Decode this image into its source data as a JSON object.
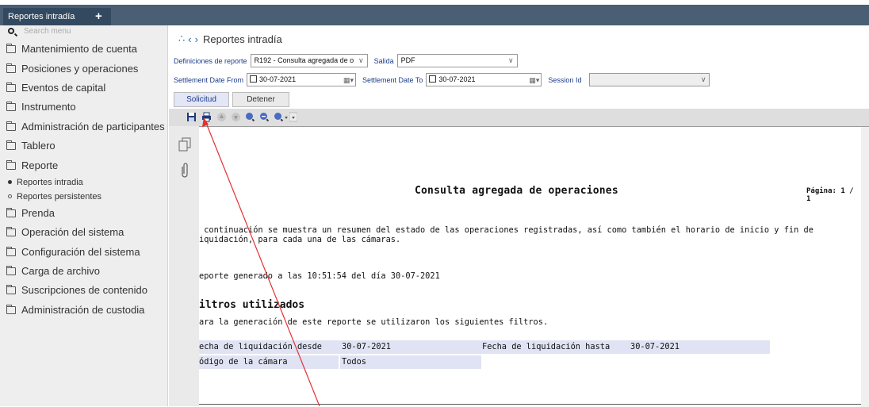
{
  "tab": {
    "title": "Reportes intradía",
    "add_icon": "plus-icon"
  },
  "sidebar": {
    "search_placeholder": "Search menu",
    "items": [
      {
        "label": "Mantenimiento de cuenta",
        "icon": "folder-icon"
      },
      {
        "label": "Posiciones y operaciones",
        "icon": "folder-icon"
      },
      {
        "label": "Eventos de capital",
        "icon": "folder-icon"
      },
      {
        "label": "Instrumento",
        "icon": "folder-icon"
      },
      {
        "label": "Administración de participantes",
        "icon": "folder-icon"
      },
      {
        "label": "Tablero",
        "icon": "folder-icon"
      },
      {
        "label": "Reporte",
        "icon": "folder-open-icon"
      }
    ],
    "subitems": [
      {
        "label": "Reportes intradia"
      },
      {
        "label": "Reportes persistentes"
      }
    ],
    "items2": [
      {
        "label": "Prenda"
      },
      {
        "label": "Operación del sistema"
      },
      {
        "label": "Configuración del sistema"
      },
      {
        "label": "Carga de archivo"
      },
      {
        "label": "Suscripciones de contenido"
      },
      {
        "label": "Administración de custodia"
      }
    ]
  },
  "header": {
    "title": "Reportes intradía"
  },
  "form": {
    "def_label": "Definiciones de reporte",
    "def_value": "R192 - Consulta agregada de o",
    "salida_label": "Salida",
    "salida_value": "PDF",
    "from_label": "Settlement Date From",
    "from_value": "30-07-2021",
    "to_label": "Settlement Date To",
    "to_value": "30-07-2021",
    "session_label": "Session Id",
    "session_value": ""
  },
  "buttons": {
    "solicitud": "Solicitud",
    "detener": "Detener"
  },
  "document": {
    "title": "Consulta agregada de operaciones",
    "page": "Página: 1 / 1",
    "intro_line1": " continuación se muestra un resumen del estado de las operaciones registradas, así como también el horario de inicio y fin de",
    "intro_line2": "iquidación, para cada una de las cámaras.",
    "generated": "eporte generado a las 10:51:54 del día 30-07-2021",
    "filters_heading": "iltros utilizados",
    "filters_intro": "ara la generación de este reporte se utilizaron los siguientes filtros.",
    "row1_label": "echa de liquidación desde",
    "row1_value": "30-07-2021",
    "row1_label2": "Fecha de liquidación hasta",
    "row1_value2": "30-07-2021",
    "row2_label": "ódigo de la cámara",
    "row2_value": "Todos"
  },
  "colors": {
    "accent": "#1b6ca8",
    "header_band": "#4a5f73",
    "annotation": "#e53030"
  }
}
